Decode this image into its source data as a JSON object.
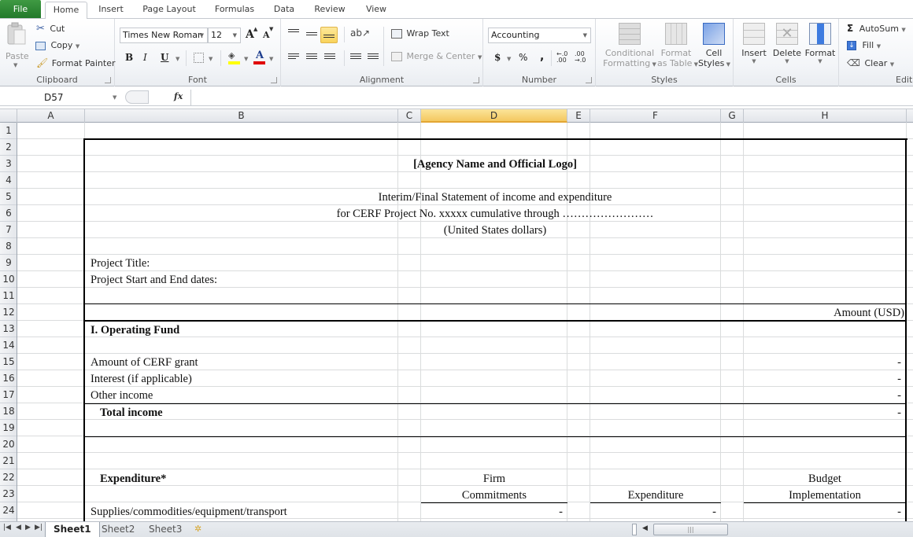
{
  "tabs": [
    {
      "label": "File"
    },
    {
      "label": "Home"
    },
    {
      "label": "Insert"
    },
    {
      "label": "Page Layout"
    },
    {
      "label": "Formulas"
    },
    {
      "label": "Data"
    },
    {
      "label": "Review"
    },
    {
      "label": "View"
    }
  ],
  "ribbon": {
    "clipboard": {
      "label": "Clipboard",
      "paste": "Paste",
      "cut": "Cut",
      "copy": "Copy",
      "format_painter": "Format Painter"
    },
    "font": {
      "label": "Font",
      "font_name": "Times New Roman",
      "font_size": "12",
      "bold": "B",
      "italic": "I",
      "underline": "U",
      "grow": "A",
      "shrink": "A",
      "font_color": "A",
      "fill_color_hex": "#ffff00",
      "font_color_hex": "#e00000"
    },
    "alignment": {
      "label": "Alignment",
      "wrap_text": "Wrap Text",
      "merge_center": "Merge & Center",
      "active_vertical": "bottom"
    },
    "number": {
      "label": "Number",
      "format": "Accounting",
      "currency": "$",
      "percent": "%",
      "comma": ",",
      "inc_decimal": "+.0 .00",
      "dec_decimal": ".00 +.0"
    },
    "styles": {
      "label": "Styles",
      "conditional_formatting": [
        "Conditional",
        "Formatting"
      ],
      "format_as_table": [
        "Format",
        "as Table"
      ],
      "cell_styles": [
        "Cell",
        "Styles"
      ]
    },
    "cells": {
      "label": "Cells",
      "insert": "Insert",
      "delete": "Delete",
      "format": "Format"
    },
    "editing": {
      "label": "Editi",
      "autosum": "AutoSum",
      "fill": "Fill",
      "clear": "Clear"
    }
  },
  "formula_bar": {
    "name_box": "D57",
    "fx": "fx",
    "value": ""
  },
  "columns": [
    "A",
    "B",
    "C",
    "D",
    "E",
    "F",
    "G",
    "H"
  ],
  "selected_column": "D",
  "rows": [
    "1",
    "2",
    "3",
    "4",
    "5",
    "6",
    "7",
    "8",
    "9",
    "10",
    "11",
    "12",
    "13",
    "14",
    "15",
    "16",
    "17",
    "18",
    "19",
    "20",
    "21",
    "22",
    "23",
    "24"
  ],
  "cells": {
    "r3_title": "[Agency Name and Official Logo]",
    "r5_line1": "Interim/Final Statement of income and expenditure",
    "r6_line2": "for CERF Project No. xxxxx cumulative through  ……………………",
    "r7_line3": "(United States dollars)",
    "r9_project_title": "Project Title:",
    "r10_project_dates": "Project Start and End dates:",
    "r12_amount_header": "Amount (USD)",
    "r13_section": "I. Operating Fund",
    "r15_cerf_grant": "Amount of CERF grant",
    "r15_value": "-",
    "r16_interest": "Interest (if applicable)",
    "r16_value": "-",
    "r17_other_income": "Other income",
    "r17_value": "-",
    "r18_total_income": "Total income",
    "r18_value": "-",
    "r22_expenditure": "Expenditure*",
    "r22_firm": "Firm",
    "r23_commitments": "Commitments",
    "r23_expenditure": "Expenditure",
    "r22_budget": "Budget",
    "r23_implementation": "Implementation",
    "r24_supplies": "Supplies/commodities/equipment/transport",
    "r24_d": "-",
    "r24_f": "-",
    "r24_h": "-"
  },
  "sheet_tabs": [
    {
      "label": "Sheet1",
      "active": true
    },
    {
      "label": "Sheet2",
      "active": false
    },
    {
      "label": "Sheet3",
      "active": false
    }
  ]
}
